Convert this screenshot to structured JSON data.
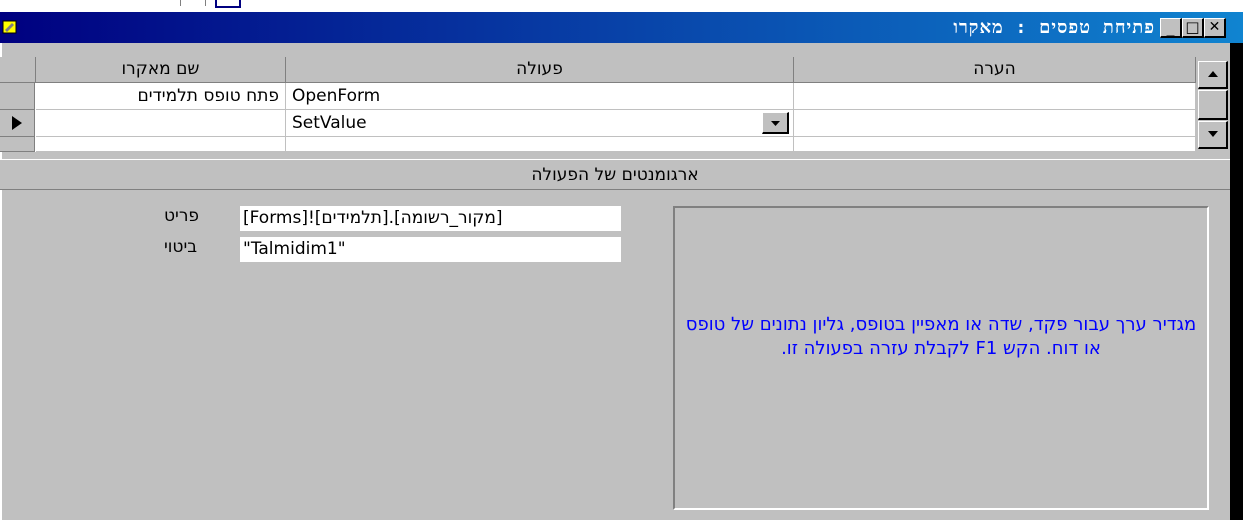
{
  "window": {
    "title": "פתיחת טפסים : מאקרו",
    "buttons": {
      "minimize": "_",
      "maximize": "□",
      "close": "✕"
    }
  },
  "grid": {
    "headers": {
      "macro_name": "שם מאקרו",
      "action": "פעולה",
      "comment": "הערה"
    },
    "rows": [
      {
        "macro_name": "פתח טופס תלמידים",
        "action": "OpenForm",
        "comment": ""
      },
      {
        "macro_name": "",
        "action": "SetValue",
        "comment": "",
        "current": true
      },
      {
        "macro_name": "",
        "action": "",
        "comment": ""
      }
    ]
  },
  "arguments": {
    "section_title": "ארגומנטים של הפעולה",
    "item_label": "פריט",
    "item_value": "[Forms]![תלמידים].[מקור_רשומה]",
    "expression_label": "ביטוי",
    "expression_value": "\"Talmidim1\"",
    "help_text": "מגדיר ערך עבור פקד, שדה או מאפיין בטופס, גליון נתונים של טופס או דוח. הקש F1 לקבלת עזרה בפעולה זו."
  },
  "colors": {
    "title_gradient_start": "#000080",
    "title_gradient_end": "#1084d0",
    "help_text": "#0000ff",
    "face": "#c0c0c0"
  }
}
